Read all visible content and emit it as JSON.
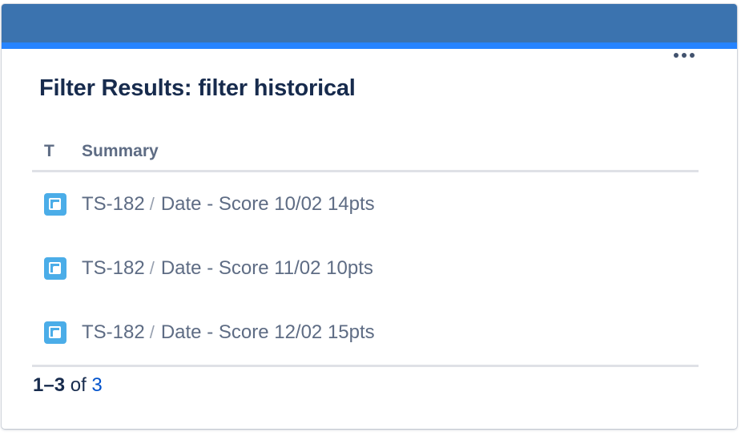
{
  "gadget": {
    "title": "Filter Results: filter historical",
    "more_icon": "more-horizontal-icon"
  },
  "table": {
    "columns": [
      "T",
      "Summary"
    ],
    "rows": [
      {
        "type_icon": "subtask-icon",
        "key": "TS-182",
        "separator": "/",
        "summary": "Date - Score 10/02 14pts"
      },
      {
        "type_icon": "subtask-icon",
        "key": "TS-182",
        "separator": "/",
        "summary": "Date - Score 11/02 10pts"
      },
      {
        "type_icon": "subtask-icon",
        "key": "TS-182",
        "separator": "/",
        "summary": "Date - Score 12/02 15pts"
      }
    ]
  },
  "pagination": {
    "range": "1–3",
    "of": "of",
    "total": "3"
  },
  "colors": {
    "header": "#3b73af",
    "header_accent": "#2684ff",
    "link": "#0052cc",
    "icon": "#4bade8"
  }
}
